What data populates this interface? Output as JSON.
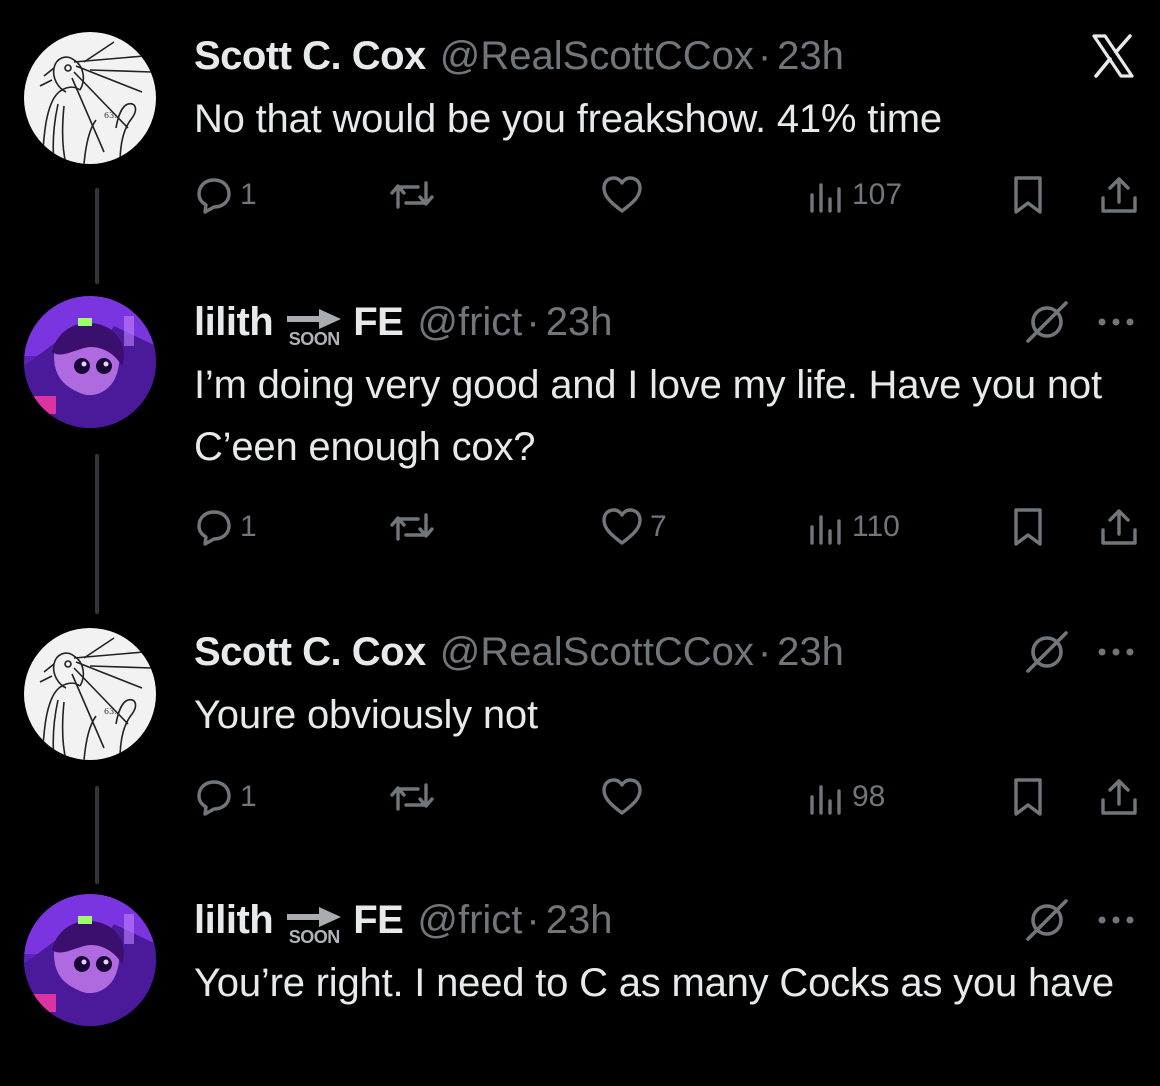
{
  "tweets": [
    {
      "author": "Scott C. Cox",
      "handle": "@RealScottCCox",
      "separator": "·",
      "time": "23h",
      "text": "No that would be you freakshow. 41% time",
      "has_soon_badge": false,
      "top_right_icon": "x-logo-icon",
      "replies": "1",
      "reposts": "",
      "likes": "",
      "views": "107"
    },
    {
      "author": "lilith",
      "badge_text": "SOON",
      "author_suffix": "FE",
      "handle": "@frict",
      "separator": "·",
      "time": "23h",
      "text": "I’m doing very good and I love my life. Have you not C’een enough cox?",
      "has_soon_badge": true,
      "top_right_icon": "muted-icon",
      "replies": "1",
      "reposts": "",
      "likes": "7",
      "views": "110"
    },
    {
      "author": "Scott C. Cox",
      "handle": "@RealScottCCox",
      "separator": "·",
      "time": "23h",
      "text": "Youre obviously not",
      "has_soon_badge": false,
      "top_right_icon": "muted-icon",
      "replies": "1",
      "reposts": "",
      "likes": "",
      "views": "98"
    },
    {
      "author": "lilith",
      "badge_text": "SOON",
      "author_suffix": "FE",
      "handle": "@frict",
      "separator": "·",
      "time": "23h",
      "text": "You’re right. I need to C as many Cocks as you have",
      "has_soon_badge": true,
      "top_right_icon": "muted-icon",
      "replies": "",
      "reposts": "",
      "likes": "",
      "views": ""
    }
  ],
  "colors": {
    "background": "#000000",
    "text_primary": "#e7e9ea",
    "text_secondary": "#71767b",
    "thread_line": "#333639",
    "avatar_purple": "#6a2bd1"
  }
}
